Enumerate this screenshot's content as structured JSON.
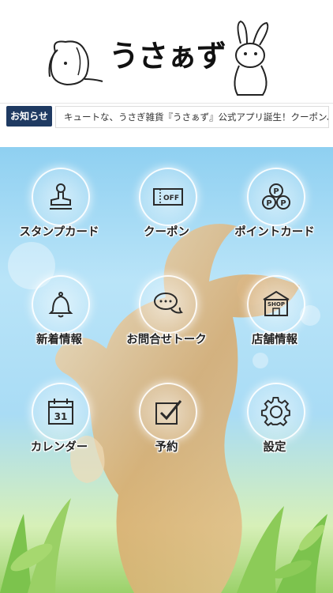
{
  "header": {
    "logo_text": "うさぁず"
  },
  "news": {
    "badge": "お知らせ",
    "text": "キュートな、うさぎ雑貨『うさぁず』公式アプリ誕生！クーポン、スタンプカード"
  },
  "menu": {
    "items": [
      {
        "label": "スタンプカード",
        "icon": "stamp-icon"
      },
      {
        "label": "クーポン",
        "icon": "coupon-icon",
        "icon_text": "OFF"
      },
      {
        "label": "ポイントカード",
        "icon": "point-card-icon"
      },
      {
        "label": "新着情報",
        "icon": "bell-icon"
      },
      {
        "label": "お問合せトーク",
        "icon": "chat-icon"
      },
      {
        "label": "店舗情報",
        "icon": "shop-icon",
        "icon_text": "SHOP"
      },
      {
        "label": "カレンダー",
        "icon": "calendar-icon",
        "icon_text": "31"
      },
      {
        "label": "予約",
        "icon": "checkbox-icon"
      },
      {
        "label": "設定",
        "icon": "gear-icon"
      }
    ]
  },
  "colors": {
    "badge": "#1f3a62",
    "icon_stroke": "#2a2a2a"
  }
}
